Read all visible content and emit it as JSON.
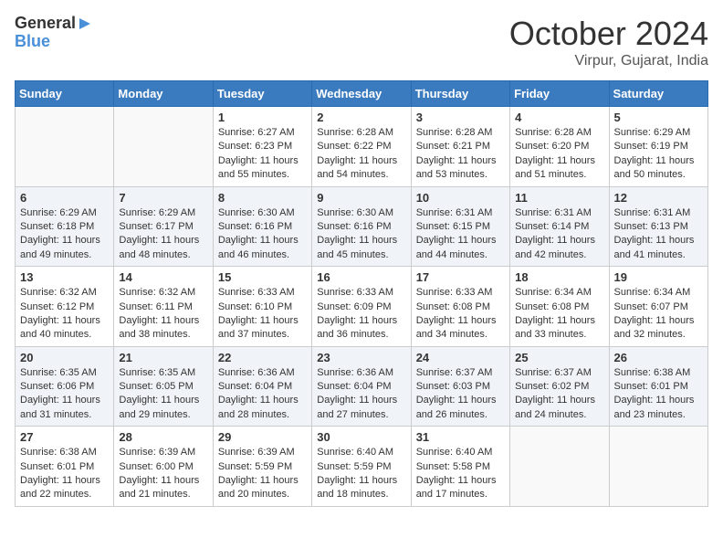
{
  "header": {
    "logo_line1": "General",
    "logo_line2": "Blue",
    "month": "October 2024",
    "location": "Virpur, Gujarat, India"
  },
  "weekdays": [
    "Sunday",
    "Monday",
    "Tuesday",
    "Wednesday",
    "Thursday",
    "Friday",
    "Saturday"
  ],
  "weeks": [
    [
      {
        "day": "",
        "sunrise": "",
        "sunset": "",
        "daylight": ""
      },
      {
        "day": "",
        "sunrise": "",
        "sunset": "",
        "daylight": ""
      },
      {
        "day": "1",
        "sunrise": "Sunrise: 6:27 AM",
        "sunset": "Sunset: 6:23 PM",
        "daylight": "Daylight: 11 hours and 55 minutes."
      },
      {
        "day": "2",
        "sunrise": "Sunrise: 6:28 AM",
        "sunset": "Sunset: 6:22 PM",
        "daylight": "Daylight: 11 hours and 54 minutes."
      },
      {
        "day": "3",
        "sunrise": "Sunrise: 6:28 AM",
        "sunset": "Sunset: 6:21 PM",
        "daylight": "Daylight: 11 hours and 53 minutes."
      },
      {
        "day": "4",
        "sunrise": "Sunrise: 6:28 AM",
        "sunset": "Sunset: 6:20 PM",
        "daylight": "Daylight: 11 hours and 51 minutes."
      },
      {
        "day": "5",
        "sunrise": "Sunrise: 6:29 AM",
        "sunset": "Sunset: 6:19 PM",
        "daylight": "Daylight: 11 hours and 50 minutes."
      }
    ],
    [
      {
        "day": "6",
        "sunrise": "Sunrise: 6:29 AM",
        "sunset": "Sunset: 6:18 PM",
        "daylight": "Daylight: 11 hours and 49 minutes."
      },
      {
        "day": "7",
        "sunrise": "Sunrise: 6:29 AM",
        "sunset": "Sunset: 6:17 PM",
        "daylight": "Daylight: 11 hours and 48 minutes."
      },
      {
        "day": "8",
        "sunrise": "Sunrise: 6:30 AM",
        "sunset": "Sunset: 6:16 PM",
        "daylight": "Daylight: 11 hours and 46 minutes."
      },
      {
        "day": "9",
        "sunrise": "Sunrise: 6:30 AM",
        "sunset": "Sunset: 6:16 PM",
        "daylight": "Daylight: 11 hours and 45 minutes."
      },
      {
        "day": "10",
        "sunrise": "Sunrise: 6:31 AM",
        "sunset": "Sunset: 6:15 PM",
        "daylight": "Daylight: 11 hours and 44 minutes."
      },
      {
        "day": "11",
        "sunrise": "Sunrise: 6:31 AM",
        "sunset": "Sunset: 6:14 PM",
        "daylight": "Daylight: 11 hours and 42 minutes."
      },
      {
        "day": "12",
        "sunrise": "Sunrise: 6:31 AM",
        "sunset": "Sunset: 6:13 PM",
        "daylight": "Daylight: 11 hours and 41 minutes."
      }
    ],
    [
      {
        "day": "13",
        "sunrise": "Sunrise: 6:32 AM",
        "sunset": "Sunset: 6:12 PM",
        "daylight": "Daylight: 11 hours and 40 minutes."
      },
      {
        "day": "14",
        "sunrise": "Sunrise: 6:32 AM",
        "sunset": "Sunset: 6:11 PM",
        "daylight": "Daylight: 11 hours and 38 minutes."
      },
      {
        "day": "15",
        "sunrise": "Sunrise: 6:33 AM",
        "sunset": "Sunset: 6:10 PM",
        "daylight": "Daylight: 11 hours and 37 minutes."
      },
      {
        "day": "16",
        "sunrise": "Sunrise: 6:33 AM",
        "sunset": "Sunset: 6:09 PM",
        "daylight": "Daylight: 11 hours and 36 minutes."
      },
      {
        "day": "17",
        "sunrise": "Sunrise: 6:33 AM",
        "sunset": "Sunset: 6:08 PM",
        "daylight": "Daylight: 11 hours and 34 minutes."
      },
      {
        "day": "18",
        "sunrise": "Sunrise: 6:34 AM",
        "sunset": "Sunset: 6:08 PM",
        "daylight": "Daylight: 11 hours and 33 minutes."
      },
      {
        "day": "19",
        "sunrise": "Sunrise: 6:34 AM",
        "sunset": "Sunset: 6:07 PM",
        "daylight": "Daylight: 11 hours and 32 minutes."
      }
    ],
    [
      {
        "day": "20",
        "sunrise": "Sunrise: 6:35 AM",
        "sunset": "Sunset: 6:06 PM",
        "daylight": "Daylight: 11 hours and 31 minutes."
      },
      {
        "day": "21",
        "sunrise": "Sunrise: 6:35 AM",
        "sunset": "Sunset: 6:05 PM",
        "daylight": "Daylight: 11 hours and 29 minutes."
      },
      {
        "day": "22",
        "sunrise": "Sunrise: 6:36 AM",
        "sunset": "Sunset: 6:04 PM",
        "daylight": "Daylight: 11 hours and 28 minutes."
      },
      {
        "day": "23",
        "sunrise": "Sunrise: 6:36 AM",
        "sunset": "Sunset: 6:04 PM",
        "daylight": "Daylight: 11 hours and 27 minutes."
      },
      {
        "day": "24",
        "sunrise": "Sunrise: 6:37 AM",
        "sunset": "Sunset: 6:03 PM",
        "daylight": "Daylight: 11 hours and 26 minutes."
      },
      {
        "day": "25",
        "sunrise": "Sunrise: 6:37 AM",
        "sunset": "Sunset: 6:02 PM",
        "daylight": "Daylight: 11 hours and 24 minutes."
      },
      {
        "day": "26",
        "sunrise": "Sunrise: 6:38 AM",
        "sunset": "Sunset: 6:01 PM",
        "daylight": "Daylight: 11 hours and 23 minutes."
      }
    ],
    [
      {
        "day": "27",
        "sunrise": "Sunrise: 6:38 AM",
        "sunset": "Sunset: 6:01 PM",
        "daylight": "Daylight: 11 hours and 22 minutes."
      },
      {
        "day": "28",
        "sunrise": "Sunrise: 6:39 AM",
        "sunset": "Sunset: 6:00 PM",
        "daylight": "Daylight: 11 hours and 21 minutes."
      },
      {
        "day": "29",
        "sunrise": "Sunrise: 6:39 AM",
        "sunset": "Sunset: 5:59 PM",
        "daylight": "Daylight: 11 hours and 20 minutes."
      },
      {
        "day": "30",
        "sunrise": "Sunrise: 6:40 AM",
        "sunset": "Sunset: 5:59 PM",
        "daylight": "Daylight: 11 hours and 18 minutes."
      },
      {
        "day": "31",
        "sunrise": "Sunrise: 6:40 AM",
        "sunset": "Sunset: 5:58 PM",
        "daylight": "Daylight: 11 hours and 17 minutes."
      },
      {
        "day": "",
        "sunrise": "",
        "sunset": "",
        "daylight": ""
      },
      {
        "day": "",
        "sunrise": "",
        "sunset": "",
        "daylight": ""
      }
    ]
  ]
}
